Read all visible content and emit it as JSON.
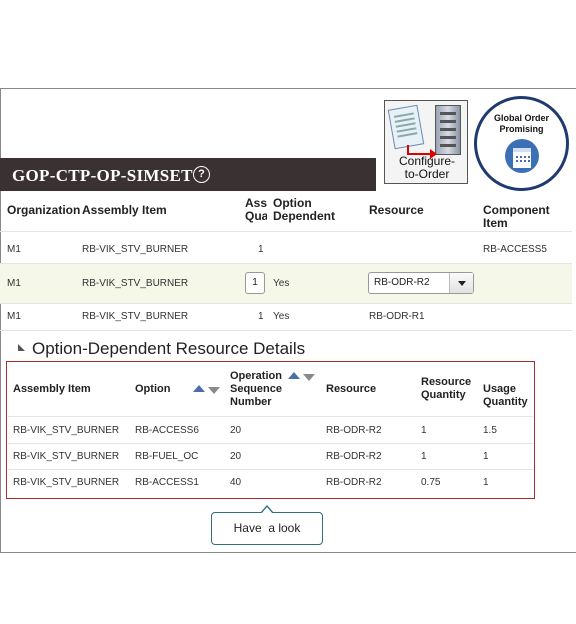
{
  "page": {
    "title": "GOP-CTP-OP-SIMSET",
    "help_icon": "question-circle-icon"
  },
  "buttons": {
    "configure_to_order": "Configure-to-Order",
    "configure_line1": "Configure-",
    "configure_line2": "to-Order",
    "global_order_promising_line1": "Global Order",
    "global_order_promising_line2": "Promising",
    "global_order_promising_icon": "calendar-icon"
  },
  "main_table": {
    "headers": {
      "organization": "Organization",
      "assembly_item": "Assembly Item",
      "assembly_quantity_line1": "Asse",
      "assembly_quantity_line2": "Qua",
      "option_dependent_line1": "Option",
      "option_dependent_line2": "Dependent",
      "resource": "Resource",
      "component_item": "Component Item"
    },
    "rows": [
      {
        "organization": "M1",
        "assembly_item": "RB-VIK_STV_BURNER",
        "quantity": "1",
        "option_dependent": "",
        "resource": "",
        "component_item": "RB-ACCESS5"
      },
      {
        "organization": "M1",
        "assembly_item": "RB-VIK_STV_BURNER",
        "quantity": "1",
        "option_dependent": "Yes",
        "resource": "RB-ODR-R2",
        "component_item": ""
      },
      {
        "organization": "M1",
        "assembly_item": "RB-VIK_STV_BURNER",
        "quantity": "1",
        "option_dependent": "Yes",
        "resource": "RB-ODR-R1",
        "component_item": ""
      }
    ]
  },
  "detail_section": {
    "title": "Option-Dependent Resource Details",
    "headers": {
      "assembly_item": "Assembly Item",
      "option": "Option",
      "operation_seq_line1": "Operation",
      "operation_seq_line2": "Sequence",
      "operation_seq_line3": "Number",
      "resource": "Resource",
      "resource_quantity_line1": "Resource",
      "resource_quantity_line2": "Quantity",
      "usage_quantity_line1": "Usage",
      "usage_quantity_line2": "Quantity"
    },
    "rows": [
      {
        "assembly_item": "RB-VIK_STV_BURNER",
        "option": "RB-ACCESS6",
        "op_seq": "20",
        "resource": "RB-ODR-R2",
        "resource_qty": "1",
        "usage_qty": "1.5"
      },
      {
        "assembly_item": "RB-VIK_STV_BURNER",
        "option": "RB-FUEL_OC",
        "op_seq": "20",
        "resource": "RB-ODR-R2",
        "resource_qty": "1",
        "usage_qty": "1"
      },
      {
        "assembly_item": "RB-VIK_STV_BURNER",
        "option": "RB-ACCESS1",
        "op_seq": "40",
        "resource": "RB-ODR-R2",
        "resource_qty": "0.75",
        "usage_qty": "1"
      }
    ]
  },
  "callout": {
    "text": "Have  a look"
  },
  "colors": {
    "title_bar": "#3a3232",
    "highlight_border": "#b22a2a",
    "selected_row": "#f5f7e8",
    "callout_border": "#2f6f7a"
  }
}
